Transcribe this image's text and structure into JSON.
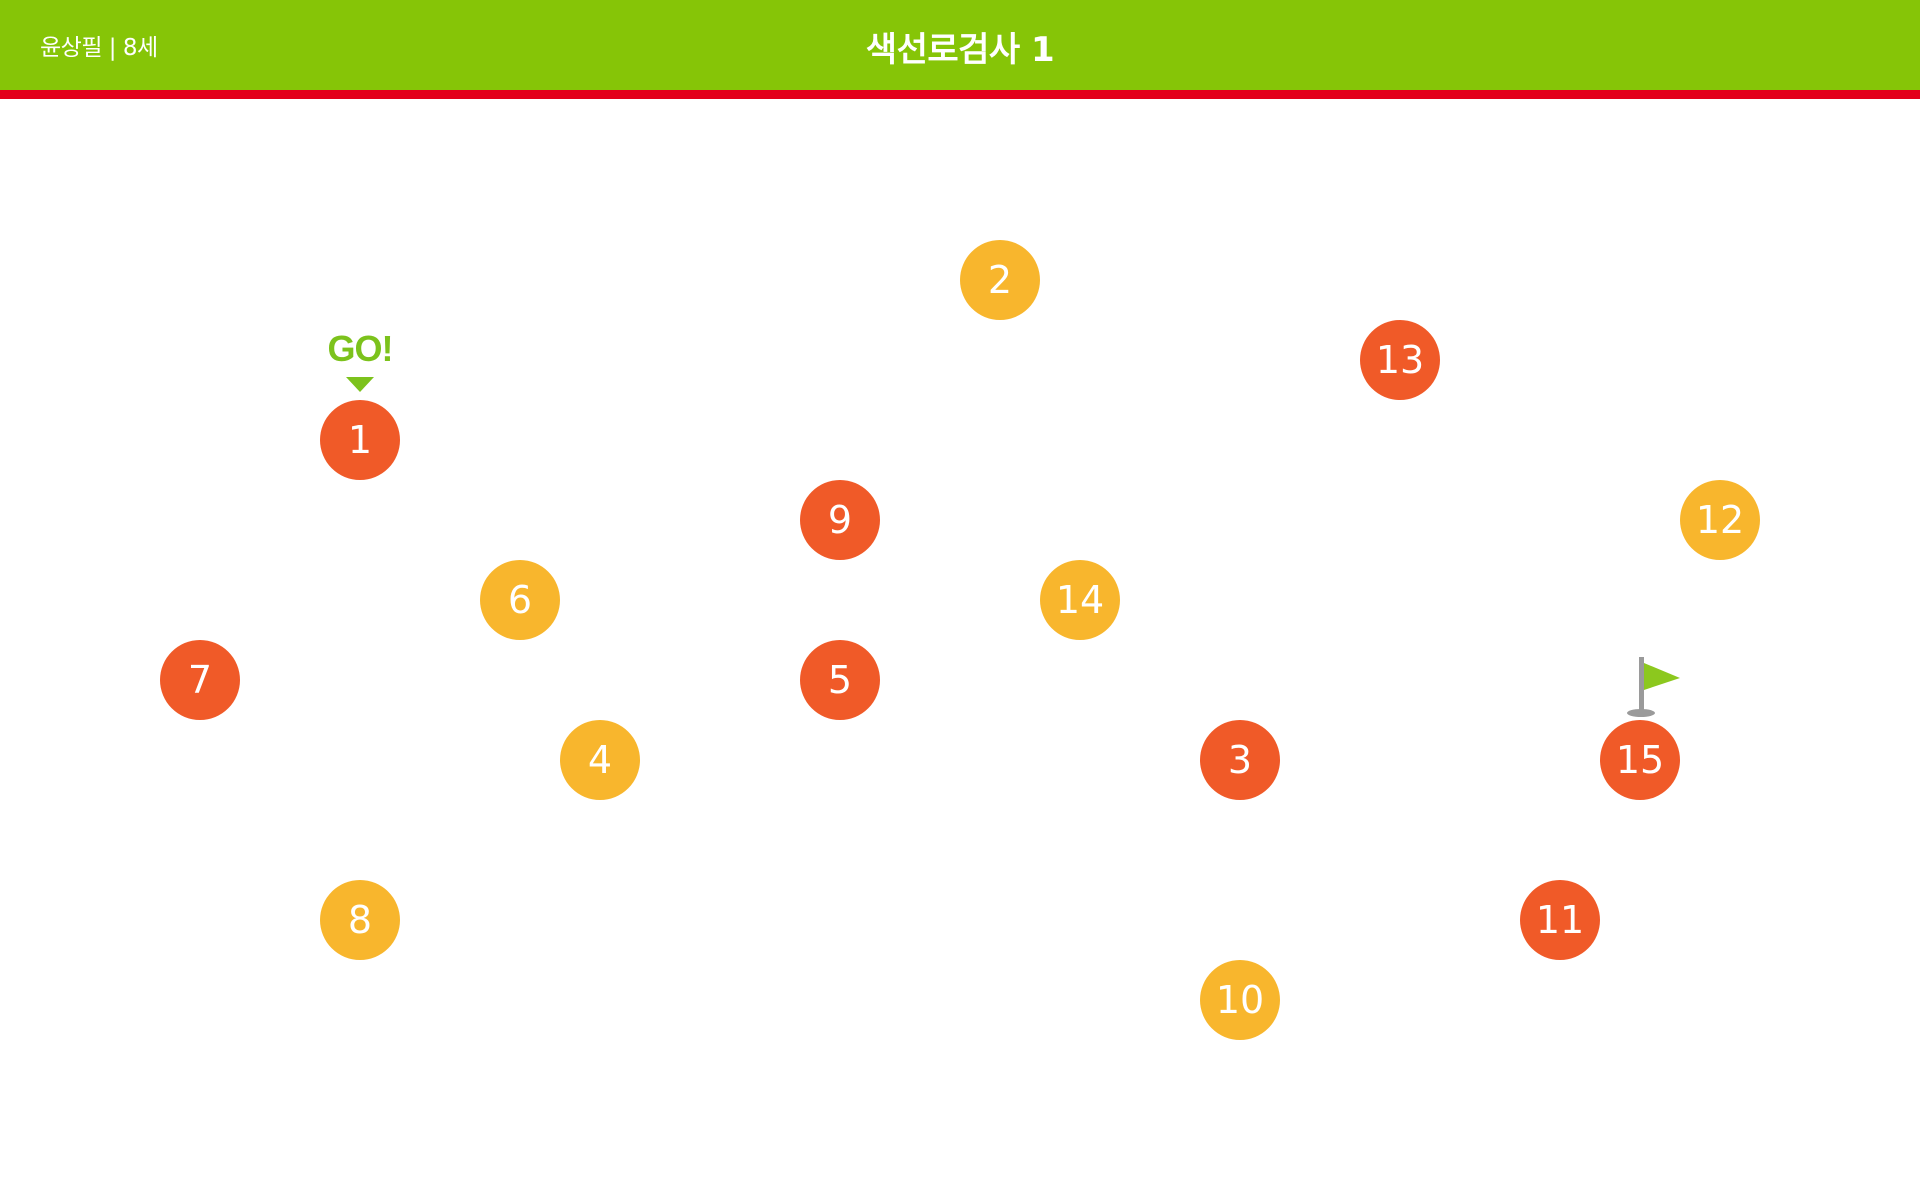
{
  "header": {
    "user_info": "윤상필 | 8세",
    "title": "색선로검사 1"
  },
  "start_marker": {
    "label": "GO!"
  },
  "finish_icon": "flag-icon",
  "colors": {
    "header_bg": "#86c507",
    "header_line": "#e3001b",
    "orange": "#f05a28",
    "yellow": "#f8b62d",
    "go_green": "#7cc21c",
    "flag_green": "#8cc81e"
  },
  "targets": [
    {
      "number": "1",
      "color": "orange"
    },
    {
      "number": "2",
      "color": "yellow"
    },
    {
      "number": "3",
      "color": "orange"
    },
    {
      "number": "4",
      "color": "yellow"
    },
    {
      "number": "5",
      "color": "orange"
    },
    {
      "number": "6",
      "color": "yellow"
    },
    {
      "number": "7",
      "color": "orange"
    },
    {
      "number": "8",
      "color": "yellow"
    },
    {
      "number": "9",
      "color": "orange"
    },
    {
      "number": "10",
      "color": "yellow"
    },
    {
      "number": "11",
      "color": "orange"
    },
    {
      "number": "12",
      "color": "yellow"
    },
    {
      "number": "13",
      "color": "orange"
    },
    {
      "number": "14",
      "color": "yellow"
    },
    {
      "number": "15",
      "color": "orange"
    }
  ]
}
